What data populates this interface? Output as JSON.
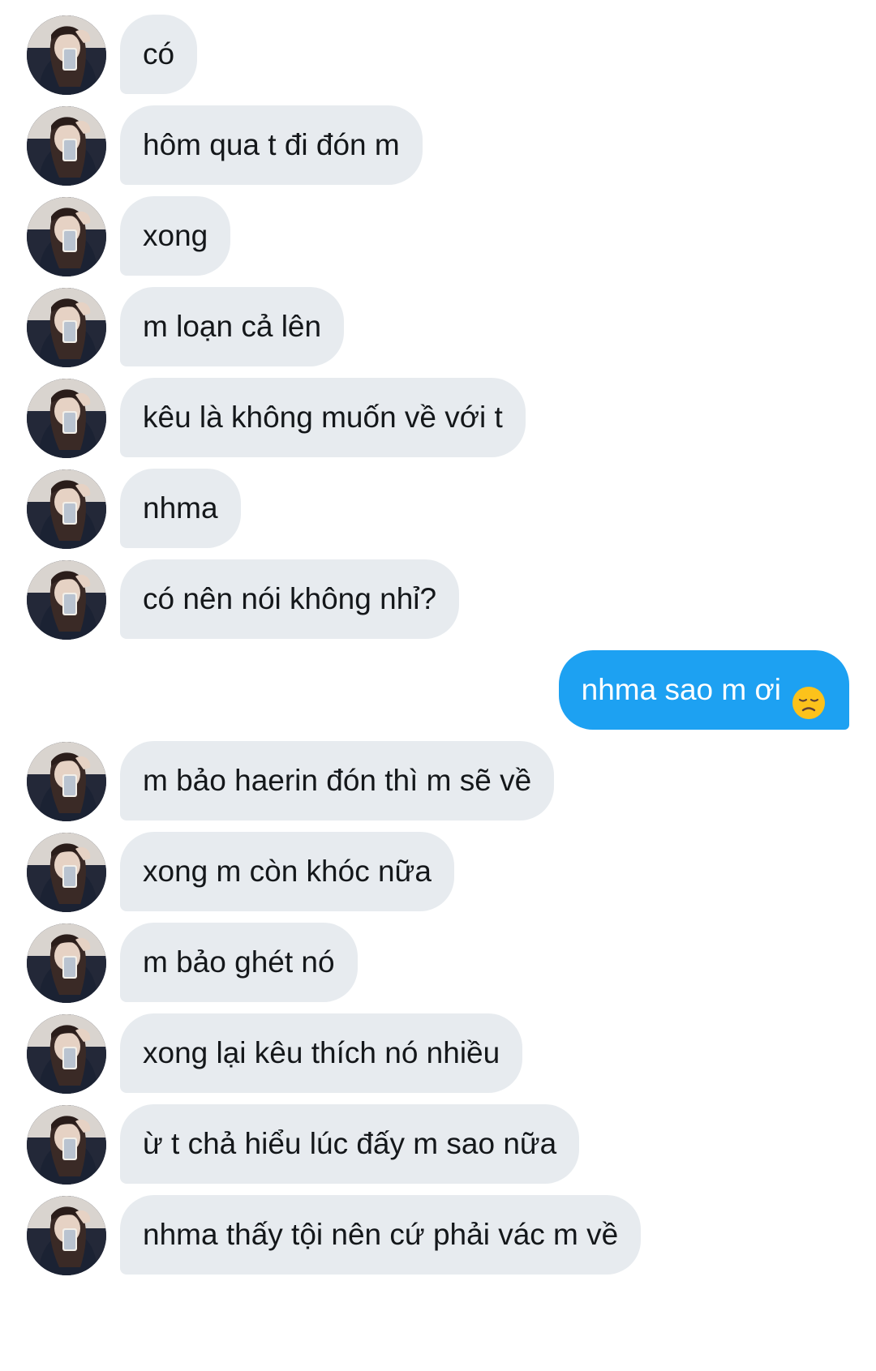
{
  "conversation": {
    "messages": [
      {
        "side": "in",
        "text": "có"
      },
      {
        "side": "in",
        "text": "hôm qua t đi đón m"
      },
      {
        "side": "in",
        "text": "xong"
      },
      {
        "side": "in",
        "text": "m loạn cả lên"
      },
      {
        "side": "in",
        "text": "kêu là không muốn về với t"
      },
      {
        "side": "in",
        "text": "nhma"
      },
      {
        "side": "in",
        "text": "có nên nói không nhỉ?"
      },
      {
        "side": "out",
        "text": "nhma sao m ơi",
        "emoji": "disappointed-face-icon"
      },
      {
        "side": "in",
        "text": "m bảo haerin đón thì m sẽ về"
      },
      {
        "side": "in",
        "text": "xong m còn khóc nữa"
      },
      {
        "side": "in",
        "text": "m bảo ghét nó"
      },
      {
        "side": "in",
        "text": "xong lại kêu thích nó nhiều"
      },
      {
        "side": "in",
        "text": "ừ t chả hiểu lúc đấy m sao nữa"
      },
      {
        "side": "in",
        "text": "nhma thấy tội nên cứ phải vác m về"
      }
    ]
  },
  "colors": {
    "incoming_bubble": "#e7ebef",
    "outgoing_bubble": "#1da1f2",
    "incoming_text": "#14171a",
    "outgoing_text": "#ffffff"
  }
}
